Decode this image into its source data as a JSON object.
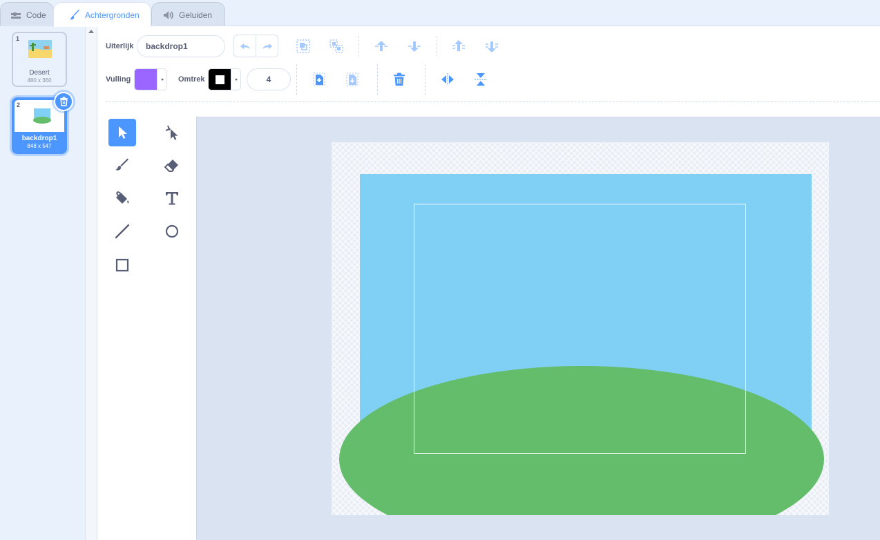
{
  "tabs": [
    {
      "label": "Code",
      "icon": "code-icon"
    },
    {
      "label": "Achtergronden",
      "icon": "paintbrush-icon"
    },
    {
      "label": "Geluiden",
      "icon": "speaker-icon"
    }
  ],
  "costumes": [
    {
      "number": "1",
      "name": "Desert",
      "size": "480 x 360"
    },
    {
      "number": "2",
      "name": "backdrop1",
      "size": "848 x 547",
      "selected": true
    }
  ],
  "editor": {
    "appearance_label": "Uiterlijk",
    "costume_name": "backdrop1",
    "fill_label": "Vulling",
    "outline_label": "Omtrek",
    "outline_width": "4",
    "fill_color": "#9966ff",
    "outline_color": "#000000"
  },
  "colors": {
    "accent": "#4c97ff",
    "sky": "#80cff5",
    "ground": "#63bd6a"
  }
}
